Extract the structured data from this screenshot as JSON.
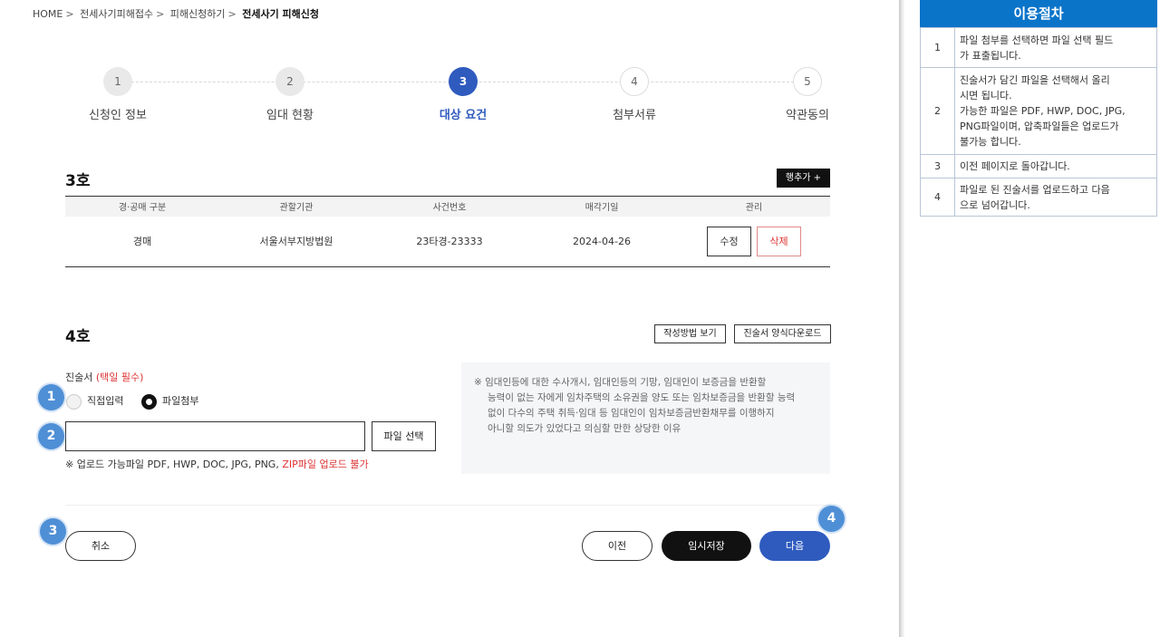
{
  "breadcrumb": [
    "HOME",
    "전세사기피해접수",
    "피해신청하기",
    "전세사기 피해신청"
  ],
  "steps": [
    {
      "num": "1",
      "label": "신청인 정보"
    },
    {
      "num": "2",
      "label": "임대 현황"
    },
    {
      "num": "3",
      "label": "대상 요건"
    },
    {
      "num": "4",
      "label": "첨부서류"
    },
    {
      "num": "5",
      "label": "약관동의"
    }
  ],
  "current_step": 3,
  "section3": {
    "title": "3호",
    "add_row_label": "행추가 +",
    "columns": [
      "경·공매 구분",
      "관할기관",
      "사건번호",
      "매각기일",
      "관리"
    ],
    "rows": [
      {
        "type": "경매",
        "court": "서울서부지방법원",
        "case_no": "23타경-23333",
        "date": "2024-04-26"
      }
    ],
    "edit_label": "수정",
    "delete_label": "삭제"
  },
  "section4": {
    "title": "4호",
    "guide_label": "작성방법 보기",
    "download_label": "진술서 양식다운로드",
    "field_label": "진술서",
    "required_label": "(택일 필수)",
    "radio_direct": "직접입력",
    "radio_file": "파일첨부",
    "selected": "file",
    "file_button": "파일 선택",
    "file_value": "",
    "note_prefix": "※ 업로드 가능파일 PDF, HWP, DOC, JPG, PNG,",
    "note_red": "ZIP파일 업로드 불가",
    "info_lines": [
      "※ 임대인등에 대한 수사개시, 임대인등의 기망, 임대인이 보증금을 반환할",
      "능력이 없는 자에게 임차주택의 소유권을 양도 또는 임차보증금을 반환할 능력",
      "없이 다수의 주택 취득·임대 등 임대인이 임차보증금반환채무를 이행하지",
      "아니할 의도가 있었다고 의심할 만한 상당한 이유"
    ]
  },
  "actions": {
    "cancel": "취소",
    "prev": "이전",
    "save": "임시저장",
    "next": "다음"
  },
  "markers": [
    "1",
    "2",
    "3",
    "4"
  ],
  "side": {
    "title": "이용절차",
    "items": [
      {
        "num": "1",
        "lines": [
          "파일 첨부를 선택하면 파일 선택 필드",
          "가 표출됩니다."
        ]
      },
      {
        "num": "2",
        "lines": [
          "진술서가 담긴 파일을 선택해서 올리",
          "시면 됩니다.",
          "가능한 파일은 PDF, HWP, DOC, JPG,",
          "PNG파일이며, 압축파일들은 업로드가",
          "불가능 합니다."
        ]
      },
      {
        "num": "3",
        "lines": [
          "이전 페이지로 돌아갑니다."
        ]
      },
      {
        "num": "4",
        "lines": [
          "파일로 된 진술서를 업로드하고 다음",
          "으로 넘어갑니다."
        ]
      }
    ]
  },
  "colors": {
    "accent": "#2f5bbf",
    "marker": "#4f8fd6",
    "side_header": "#0a74c9",
    "required": "#dd3333"
  }
}
